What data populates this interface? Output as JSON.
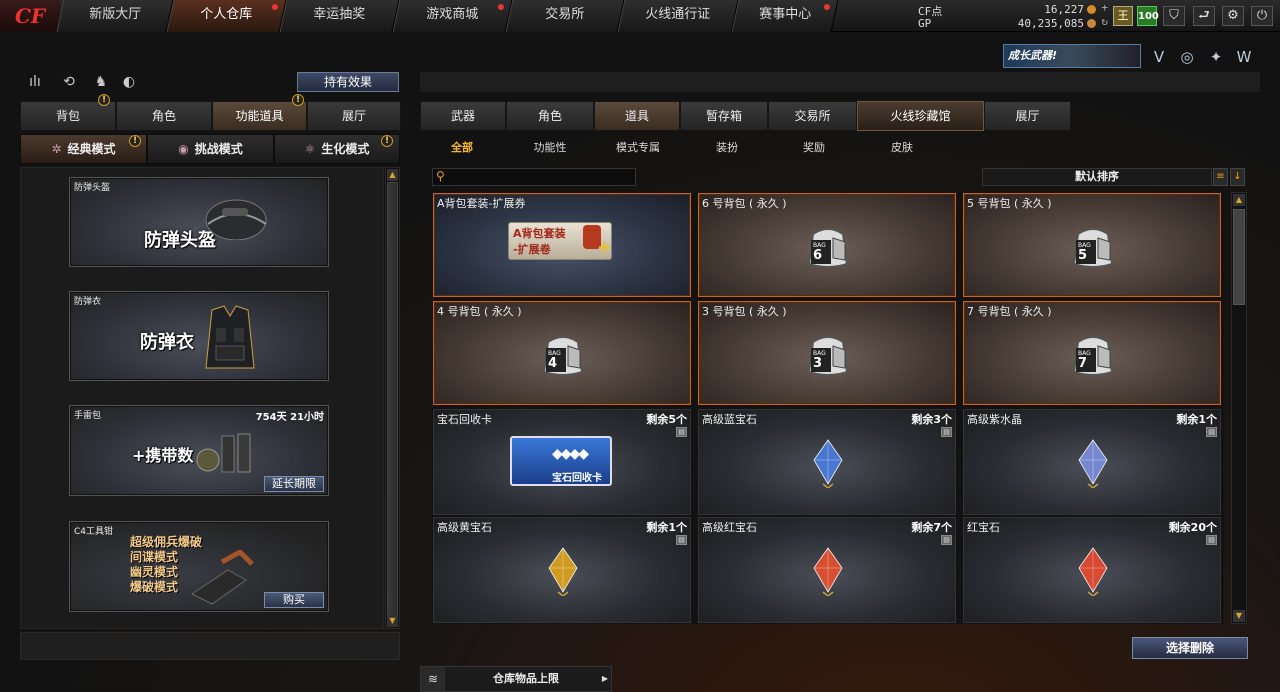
{
  "topnav": {
    "logo": "CF",
    "tabs": [
      "新版大厅",
      "个人仓库",
      "幸运抽奖",
      "游戏商城",
      "交易所",
      "火线通行证",
      "赛事中心"
    ],
    "active_tab": "个人仓库",
    "cf_label": "CF点",
    "cf_value": "16,227",
    "gp_label": "GP",
    "gp_value": "40,235,085",
    "level": "100",
    "plus": "+",
    "rank_icon": "王",
    "right_icons": [
      "shield-icon",
      "back-icon",
      "gear-icon",
      "power-icon"
    ],
    "right_glyphs": [
      "⛉",
      "⮐",
      "⚙",
      "⏻"
    ]
  },
  "promo": {
    "label": "成长武器!"
  },
  "corner_icons": [
    "badge-v-icon",
    "globe-icon",
    "crosshair-icon",
    "wing-icon"
  ],
  "corner_glyphs": [
    "V",
    "◎",
    "✦",
    "W"
  ],
  "left": {
    "icons": [
      "stats-icon",
      "refresh-icon",
      "character-icon",
      "mouse-icon"
    ],
    "icon_glyphs": [
      "ılı",
      "⟲",
      "♞",
      "◐"
    ],
    "effect_button": "持有效果",
    "tabs": [
      "背包",
      "角色",
      "功能道具",
      "展厅"
    ],
    "active_tab": "功能道具",
    "mode_tabs": [
      "经典模式",
      "挑战模式",
      "生化模式"
    ],
    "mode_icons": [
      "✲",
      "◉",
      "⚛"
    ],
    "badge": "!",
    "cards": [
      {
        "title": "防弹头盔",
        "big": "防弹头盔"
      },
      {
        "title": "防弹衣",
        "big": "防弹衣"
      },
      {
        "title": "手雷包",
        "big": "+携带数",
        "time": "754天 21小时",
        "button": "延长期限"
      },
      {
        "title": "C4工具钳",
        "lines": [
          "超级佣兵爆破",
          "间谍模式",
          "幽灵模式",
          "爆破模式"
        ],
        "button": "购买"
      }
    ]
  },
  "right": {
    "tabs": [
      "武器",
      "角色",
      "道具",
      "暂存箱",
      "交易所",
      "火线珍藏馆",
      "展厅"
    ],
    "active_tab": "道具",
    "subtabs": [
      "全部",
      "功能性",
      "模式专属",
      "装扮",
      "奖励",
      "皮肤"
    ],
    "active_subtab": "全部",
    "sort_label": "默认排序",
    "sort_icons": [
      "≡",
      "↓"
    ],
    "items": [
      {
        "name": "A背包套装-扩展券",
        "count": "",
        "type": "ticket",
        "ticket_lines": [
          "A背包套装",
          "-扩展卷"
        ]
      },
      {
        "name": "6 号背包 ( 永久 )",
        "count": "",
        "type": "bag",
        "bag_no": "6"
      },
      {
        "name": "5 号背包 ( 永久 )",
        "count": "",
        "type": "bag",
        "bag_no": "5"
      },
      {
        "name": "4 号背包 ( 永久 )",
        "count": "",
        "type": "bag",
        "bag_no": "4"
      },
      {
        "name": "3 号背包 ( 永久 )",
        "count": "",
        "type": "bag",
        "bag_no": "3"
      },
      {
        "name": "7 号背包 ( 永久 )",
        "count": "",
        "type": "bag",
        "bag_no": "7"
      },
      {
        "name": "宝石回收卡",
        "count": "剩余5个",
        "type": "card",
        "card_text": "宝石回收卡"
      },
      {
        "name": "高级蓝宝石",
        "count": "剩余3个",
        "type": "gem",
        "color": "#4a7ad8"
      },
      {
        "name": "高级紫水晶",
        "count": "剩余1个",
        "type": "gem",
        "color": "#7a8ad8"
      },
      {
        "name": "高级黄宝石",
        "count": "剩余1个",
        "type": "gem",
        "color": "#d8a020"
      },
      {
        "name": "高级红宝石",
        "count": "剩余7个",
        "type": "gem",
        "color": "#e05030"
      },
      {
        "name": "红宝石",
        "count": "剩余20个",
        "type": "gem",
        "color": "#e04a30"
      }
    ],
    "delete_button": "选择删除",
    "bottom_label": "仓库物品上限",
    "bag_text": "BAG"
  }
}
